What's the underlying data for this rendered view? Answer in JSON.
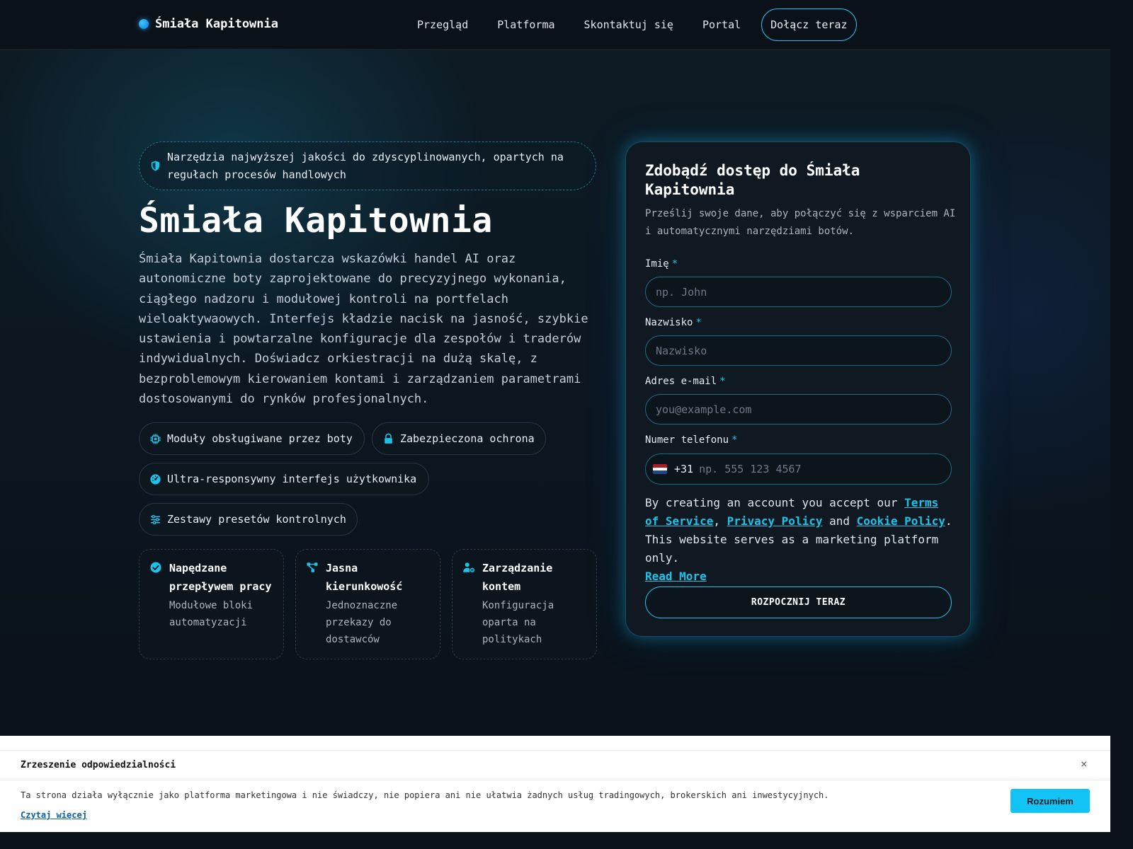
{
  "nav": {
    "brand": "Śmiała Kapitownia",
    "links": [
      "Przegląd",
      "Platforma",
      "Skontaktuj się",
      "Portal"
    ],
    "cta": "Dołącz teraz"
  },
  "hero": {
    "badge": "Narzędzia najwyższej jakości do zdyscyplinowanych, opartych na regułach procesów handlowych",
    "title": "Śmiała Kapitownia",
    "description": "Śmiała Kapitownia dostarcza wskazówki handel AI oraz autonomiczne boty zaprojektowane do precyzyjnego wykonania, ciągłego nadzoru i modułowej kontroli na portfelach wieloaktywaowych. Interfejs kładzie nacisk na jasność, szybkie ustawienia i powtarzalne konfiguracje dla zespołów i traderów indywidualnych. Doświadcz orkiestracji na dużą skalę, z bezproblemowym kierowaniem kontami i zarządzaniem parametrami dostosowanymi do rynków profesjonalnych.",
    "chips": [
      {
        "label": "Moduły obsługiwane przez boty",
        "icon": "chip-icon"
      },
      {
        "label": "Zabezpieczona ochrona",
        "icon": "lock-icon"
      },
      {
        "label": "Ultra-responsywny interfejs użytkownika",
        "icon": "gauge-icon"
      },
      {
        "label": "Zestawy presetów kontrolnych",
        "icon": "sliders-icon"
      }
    ],
    "cards": [
      {
        "title": "Napędzane przepływem pracy",
        "desc": "Modułowe bloki automatyzacji",
        "icon": "check-circle-icon"
      },
      {
        "title": "Jasna kierunkowość",
        "desc": "Jednoznaczne przekazy do dostawców",
        "icon": "branch-icon"
      },
      {
        "title": "Zarządzanie kontem",
        "desc": "Konfiguracja oparta na politykach",
        "icon": "user-gear-icon"
      }
    ]
  },
  "form": {
    "title": "Zdobądź dostęp do Śmiała Kapitownia",
    "subtitle": "Prześlij swoje dane, aby połączyć się z wsparciem AI i automatycznymi narzędziami botów.",
    "fields": {
      "first_name": {
        "label": "Imię",
        "placeholder": "np. John"
      },
      "last_name": {
        "label": "Nazwisko",
        "placeholder": "Nazwisko"
      },
      "email": {
        "label": "Adres e-mail",
        "placeholder": "you@example.com"
      },
      "phone": {
        "label": "Numer telefonu",
        "dial_code": "+31",
        "placeholder": "np. 555 123 4567"
      }
    },
    "required_mark": "*",
    "terms": {
      "prefix": "By creating an account you accept our",
      "tos": "Terms of Service",
      "comma": ",",
      "privacy": "Privacy Policy",
      "and": "and",
      "cookie": "Cookie Policy",
      "suffix": ". This website serves as a marketing platform only.",
      "read_more": "Read More"
    },
    "submit": "ROZPOCZNIJ TERAZ"
  },
  "cookie": {
    "title": "Zrzeszenie odpowiedzialności",
    "close": "×",
    "text": "Ta strona działa wyłącznie jako platforma marketingowa i nie świadczy, nie popiera ani nie ułatwia żadnych usług tradingowych, brokerskich ani inwestycyjnych.",
    "link": "Czytaj więcej",
    "button": "Rozumiem"
  },
  "colors": {
    "accent": "#1cc3e8",
    "background": "#0b1219",
    "panel": "#101922",
    "cookie_button": "#11c4f5"
  }
}
